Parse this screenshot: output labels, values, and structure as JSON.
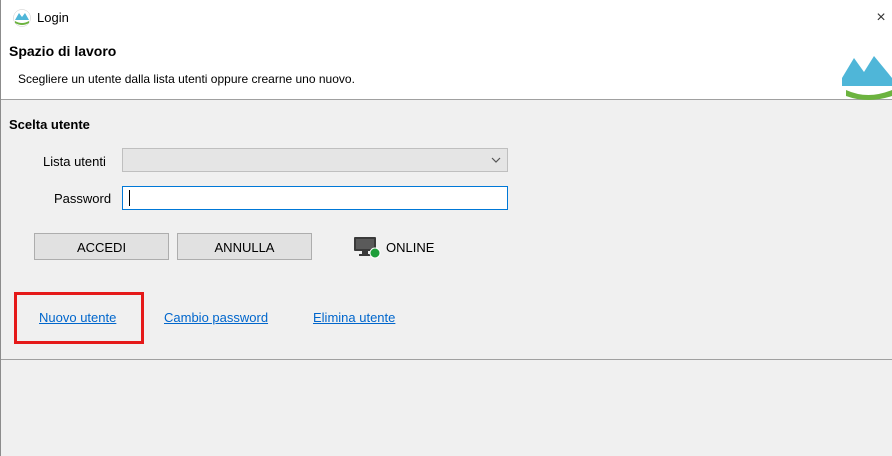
{
  "window": {
    "title": "Login",
    "close_glyph": "×"
  },
  "header": {
    "title": "Spazio di lavoro",
    "subtitle": "Scegliere un utente dalla lista utenti oppure crearne uno nuovo."
  },
  "form": {
    "section_title": "Scelta utente",
    "user_list_label": "Lista utenti",
    "user_list_value": "",
    "password_label": "Password",
    "password_value": ""
  },
  "buttons": {
    "login": "ACCEDI",
    "cancel": "ANNULLA"
  },
  "status": {
    "text": "ONLINE",
    "color": "#1e9e3a"
  },
  "links": {
    "new_user": "Nuovo utente",
    "change_password": "Cambio password",
    "delete_user": "Elimina utente"
  },
  "colors": {
    "link": "#0066cc",
    "highlight": "#e51919",
    "logo_blue": "#4fb6d8",
    "logo_green": "#6cb33f"
  },
  "icons": {
    "app": "app-logo-icon",
    "close": "close-icon",
    "dropdown": "chevron-down-icon",
    "status": "monitor-online-icon"
  }
}
